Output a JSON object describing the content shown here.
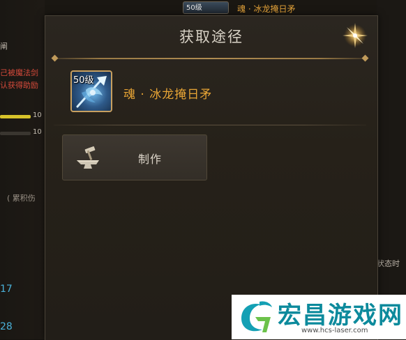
{
  "background": {
    "left_texts": [
      "阐",
      "己被魔法剑",
      "认获得助励",
      "(  累积伤"
    ],
    "bar_values": [
      "10",
      "10"
    ],
    "blue_numbers": [
      "17",
      "28"
    ],
    "right_text": "状态时",
    "top_item_level": "50级",
    "top_item_name": "魂 · 冰龙掩日矛"
  },
  "dialog": {
    "title": "获取途径",
    "item": {
      "level": "50级",
      "name": "魂 · 冰龙掩日矛",
      "icon": "ice-dragon-spear-icon"
    },
    "craft_button_label": "制作",
    "craft_icon": "anvil-hammer-icon",
    "close_icon": "close-star-icon"
  },
  "watermark": {
    "title": "宏昌游戏网",
    "url": "www.hcs-laser.com"
  },
  "colors": {
    "item_name": "#e8a535",
    "title": "#d8d2c6",
    "watermark": "#0c8a9c"
  }
}
